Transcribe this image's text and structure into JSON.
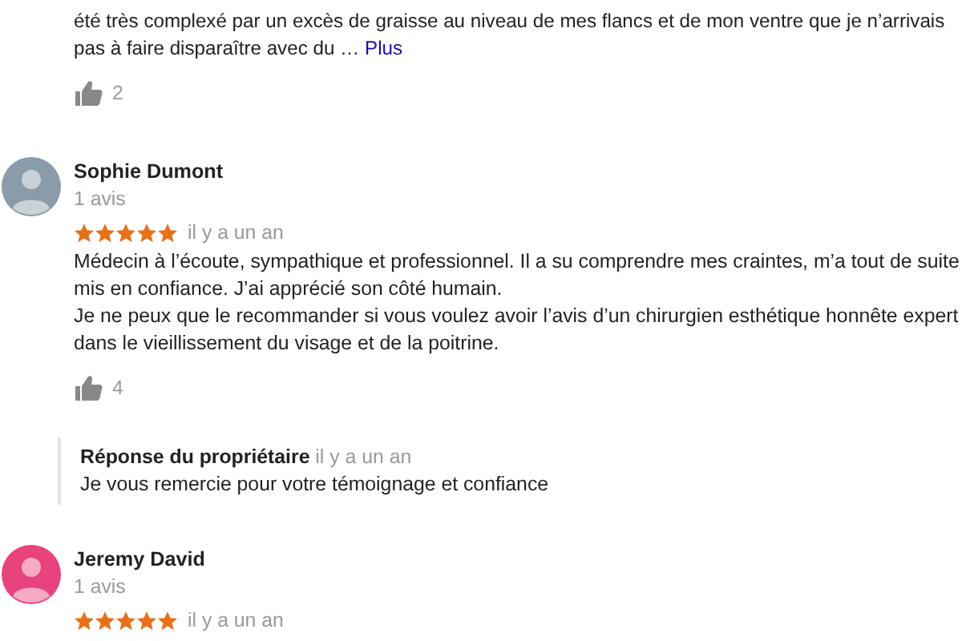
{
  "reviews": [
    {
      "text": "été très complexé par un excès de graisse au niveau de mes flancs et de mon ventre que je n’arrivais pas à faire disparaître avec du …",
      "more_link": "Plus",
      "likes": "2"
    },
    {
      "author": "Sophie Dumont",
      "color": "#8a9baa",
      "review_count": "1 avis",
      "stars": 5,
      "date": "il y a un an",
      "text": "Médecin à l’écoute, sympathique et professionnel. Il a su comprendre mes craintes, m’a tout de suite mis en confiance. J’ai apprécié son côté humain.\nJe ne peux que le recommander si vous voulez avoir l’avis d’un chirurgien esthétique honnête expert dans le vieillissement du visage et de la poitrine.",
      "likes": "4",
      "reply": {
        "title": "Réponse du propriétaire",
        "date": "il y a un an",
        "text": "Je vous remercie pour votre témoignage et confiance"
      }
    },
    {
      "author": "Jeremy David",
      "color": "#e8437f",
      "review_count": "1 avis",
      "stars": 5,
      "date": "il y a un an"
    }
  ]
}
